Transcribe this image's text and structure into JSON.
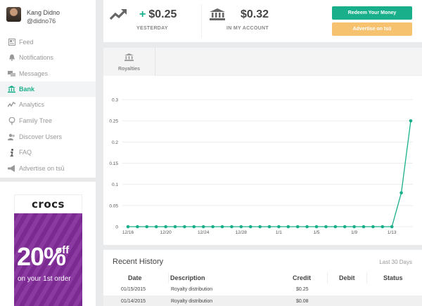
{
  "profile": {
    "name": "Kang Didno",
    "handle": "@didno76"
  },
  "nav": [
    {
      "label": "Feed",
      "icon": "feed-icon",
      "active": false
    },
    {
      "label": "Notifications",
      "icon": "bell-icon",
      "active": false
    },
    {
      "label": "Messages",
      "icon": "messages-icon",
      "active": false
    },
    {
      "label": "Bank",
      "icon": "bank-icon",
      "active": true
    },
    {
      "label": "Analytics",
      "icon": "analytics-icon",
      "active": false
    },
    {
      "label": "Family Tree",
      "icon": "tree-icon",
      "active": false
    },
    {
      "label": "Discover Users",
      "icon": "users-icon",
      "active": false
    },
    {
      "label": "FAQ",
      "icon": "info-icon",
      "active": false
    },
    {
      "label": "Advertise on tsū",
      "icon": "megaphone-icon",
      "active": false
    }
  ],
  "ad": {
    "brand": "crocs",
    "percent": "20%",
    "off": "off",
    "line": "on your 1st order"
  },
  "stats": {
    "yesterday": {
      "value": "$0.25",
      "prefix": "+",
      "label": "YESTERDAY"
    },
    "account": {
      "value": "$0.32",
      "label": "IN MY ACCOUNT"
    }
  },
  "buttons": {
    "redeem": "Redeem Your Money",
    "advertise": "Advertise on tsū"
  },
  "tabs": [
    {
      "label": "Royalties"
    }
  ],
  "colors": {
    "accent": "#1aaf8b",
    "orange": "#f7c26f",
    "ad_purple": "#7b2a91"
  },
  "chart_data": {
    "type": "line",
    "x_tick_labels": [
      "12/16",
      "12/20",
      "12/24",
      "12/28",
      "1/1",
      "1/5",
      "1/9",
      "1/13"
    ],
    "y_ticks": [
      0,
      0.05,
      0.1,
      0.15,
      0.2,
      0.25,
      0.3
    ],
    "ylim": [
      0,
      0.3
    ],
    "grid": true,
    "series": [
      {
        "values": [
          0,
          0,
          0,
          0,
          0,
          0,
          0,
          0,
          0,
          0,
          0,
          0,
          0,
          0,
          0,
          0,
          0,
          0,
          0,
          0,
          0,
          0,
          0,
          0,
          0,
          0,
          0,
          0,
          0,
          0.08,
          0.25
        ]
      }
    ]
  },
  "history": {
    "title": "Recent History",
    "range": "Last 30 Days",
    "columns": [
      "Date",
      "Description",
      "Credit",
      "Debit",
      "Status"
    ],
    "rows": [
      {
        "date": "01/15/2015",
        "description": "Royalty distribution",
        "credit": "$0.25",
        "debit": "",
        "status": ""
      },
      {
        "date": "01/14/2015",
        "description": "Royalty distribution",
        "credit": "$0.08",
        "debit": "",
        "status": ""
      }
    ]
  }
}
